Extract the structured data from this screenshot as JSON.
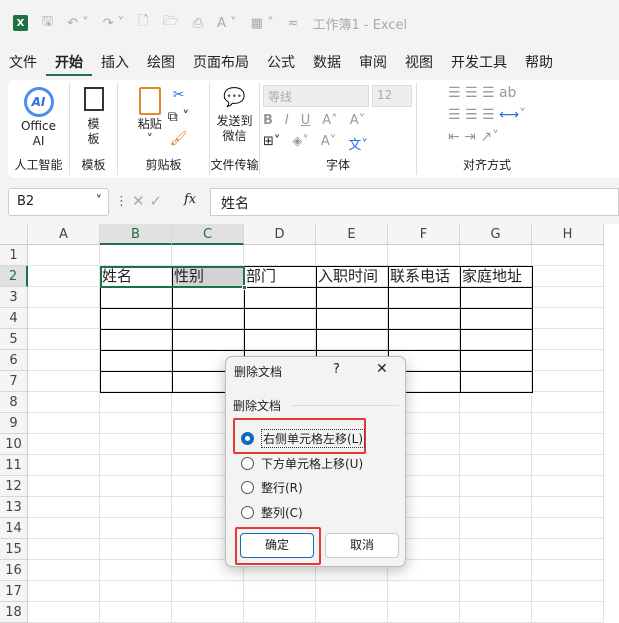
{
  "title": {
    "app": "工作簿1  -  Excel"
  },
  "tabs": [
    "文件",
    "开始",
    "插入",
    "绘图",
    "页面布局",
    "公式",
    "数据",
    "审阅",
    "视图",
    "开发工具",
    "帮助"
  ],
  "ribbon": {
    "ai": {
      "btn": "Office AI",
      "group": "人工智能"
    },
    "template": {
      "btn": "模板",
      "group": "模板"
    },
    "clipboard": {
      "paste": "粘贴",
      "group": "剪贴板"
    },
    "transfer": {
      "btn": "发送到微信",
      "group": "文件传输"
    },
    "font": {
      "name": "等线",
      "size": "12",
      "group": "字体",
      "bold": "B",
      "italic": "I",
      "underline": "U"
    },
    "align": {
      "group": "对齐方式"
    }
  },
  "formula": {
    "name_box": "B2",
    "fx": "fx",
    "value": "姓名"
  },
  "columns": [
    "A",
    "B",
    "C",
    "D",
    "E",
    "F",
    "G",
    "H"
  ],
  "rows": [
    "1",
    "2",
    "3",
    "4",
    "5",
    "6",
    "7",
    "8",
    "9",
    "10",
    "11",
    "12",
    "13",
    "14",
    "15",
    "16",
    "17",
    "18"
  ],
  "table_headers": [
    "姓名",
    "性别",
    "部门",
    "入职时间",
    "联系电话",
    "家庭地址"
  ],
  "dialog": {
    "title": "删除文档",
    "help": "?",
    "section": "删除文档",
    "options": [
      "右侧单元格左移(L)",
      "下方单元格上移(U)",
      "整行(R)",
      "整列(C)"
    ],
    "selected": 0,
    "ok": "确定",
    "cancel": "取消"
  }
}
